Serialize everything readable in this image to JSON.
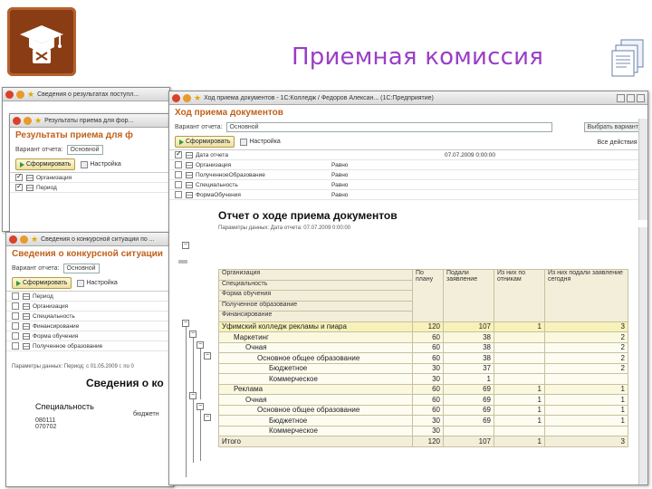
{
  "slide": {
    "title": "Приемная комиссия"
  },
  "back_window": {
    "title": "Сведения о результатах поступл..."
  },
  "left_top_window": {
    "title": "Результаты приема для фор...",
    "heading": "Результаты приема для ф",
    "variant_label": "Вариант отчета:",
    "variant_value": "Основной",
    "form_button": "Сформировать",
    "settings_button": "Настройка",
    "fields": [
      "Организация",
      "Период"
    ]
  },
  "left_bottom_window": {
    "title": "Сведения о конкурсной ситуации по ...",
    "heading": "Сведения о конкурсной ситуации",
    "variant_label": "Вариант отчета:",
    "variant_value": "Основной",
    "form_button": "Сформировать",
    "settings_button": "Настройка",
    "fields": [
      "Период",
      "Организация",
      "Специальность",
      "Финансирование",
      "Форма обучения",
      "Полученное образование"
    ],
    "params_text": "Параметры данных: Период: с 01.05.2009 г. по 0",
    "report_title": "Сведения о ко",
    "column_label": "Специальность",
    "sub_label": "бюджетн",
    "codes": [
      "080111",
      "070702"
    ]
  },
  "main_window": {
    "title": "Ход приема документов - 1С:Колледж / Федоров Алексан... (1С:Предприятие)",
    "heading": "Ход приема документов",
    "variant_label": "Вариант отчета:",
    "variant_value": "Основной",
    "choose_variant_button": "Выбрать вариант",
    "form_button": "Сформировать",
    "settings_button": "Настройка",
    "all_actions": "Все действия ▾",
    "settings_rows": [
      {
        "checked": true,
        "name": "Дата отчета",
        "op": "",
        "value": "07.07.2009 0:00:00"
      },
      {
        "checked": false,
        "name": "Организация",
        "op": "Равно",
        "value": ""
      },
      {
        "checked": false,
        "name": "ПолученноеОбразование",
        "op": "Равно",
        "value": ""
      },
      {
        "checked": false,
        "name": "Специальность",
        "op": "Равно",
        "value": ""
      },
      {
        "checked": false,
        "name": "ФормаОбучения",
        "op": "Равно",
        "value": ""
      }
    ],
    "report_title": "Отчет о ходе приема документов",
    "params_text": "Параметры данных:    Дата отчета:    07.07.2009 0:00:00",
    "grouping_labels": [
      "Организация",
      "Специальность",
      "Форма обучения",
      "Полученное образование",
      "Финансирование"
    ],
    "columns": [
      "По плану",
      "Подали заявление",
      "Из них по отникам",
      "Из них подали заявление сегодня"
    ],
    "rows": [
      {
        "level": 0,
        "name": "Уфимский колледж рекламы и пиара",
        "plan": "120",
        "applied": "107",
        "a": "1",
        "b": "3"
      },
      {
        "level": 1,
        "name": "Маркетинг",
        "plan": "60",
        "applied": "38",
        "a": "",
        "b": "2"
      },
      {
        "level": 2,
        "name": "Очная",
        "plan": "60",
        "applied": "38",
        "a": "",
        "b": "2"
      },
      {
        "level": 3,
        "name": "Основное общее образование",
        "plan": "60",
        "applied": "38",
        "a": "",
        "b": "2"
      },
      {
        "level": 4,
        "name": "Бюджетное",
        "plan": "30",
        "applied": "37",
        "a": "",
        "b": "2"
      },
      {
        "level": 4,
        "name": "Коммерческое",
        "plan": "30",
        "applied": "1",
        "a": "",
        "b": ""
      },
      {
        "level": 1,
        "name": "Реклама",
        "plan": "60",
        "applied": "69",
        "a": "1",
        "b": "1"
      },
      {
        "level": 2,
        "name": "Очная",
        "plan": "60",
        "applied": "69",
        "a": "1",
        "b": "1"
      },
      {
        "level": 3,
        "name": "Основное общее образование",
        "plan": "60",
        "applied": "69",
        "a": "1",
        "b": "1"
      },
      {
        "level": 4,
        "name": "Бюджетное",
        "plan": "30",
        "applied": "69",
        "a": "1",
        "b": "1"
      },
      {
        "level": 4,
        "name": "Коммерческое",
        "plan": "30",
        "applied": "",
        "a": "",
        "b": ""
      },
      {
        "level": -1,
        "name": "Итого",
        "plan": "120",
        "applied": "107",
        "a": "1",
        "b": "3"
      }
    ]
  },
  "colors": {
    "title_purple": "#9a3ec7",
    "heading_orange": "#c0601a",
    "logo_brown": "#8a3d14",
    "group_yellow": "#f6f2b9"
  }
}
